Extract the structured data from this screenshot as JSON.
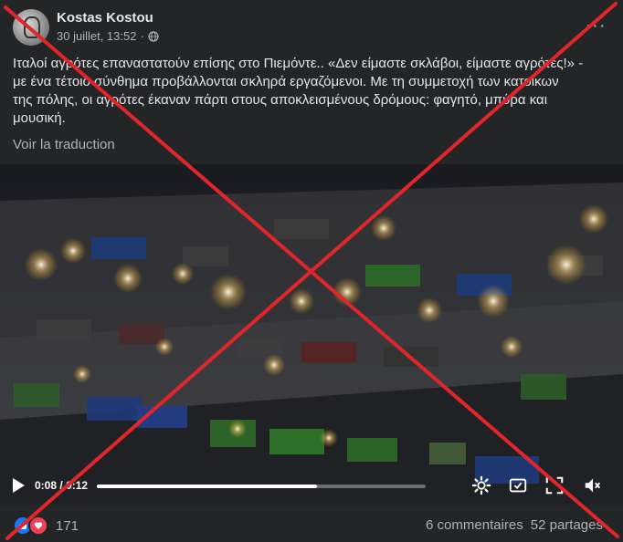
{
  "post": {
    "author": "Kostas Kostou",
    "date": "30 juillet, 13:52",
    "date_separator": "·",
    "text_lines": [
      "Ιταλοί αγρότες επαναστατούν επίσης στο Πιεμόντε.. «Δεν είμαστε σκλάβοι, είμαστε αγρότες!» -",
      "με ένα τέτοιο σύνθημα προβάλλονται σκληρά εργαζόμενοι.  Με τη συμμετοχή των κατοίκων",
      "της πόλης, οι αγρότες έκαναν πάρτι στους αποκλεισμένους δρόμους: φαγητό, μπύρα και",
      "μουσική."
    ],
    "translate_label": "Voir la traduction",
    "more_label": "···"
  },
  "video": {
    "current_time": "0:08",
    "separator": "/",
    "duration": "0:12",
    "progress_fraction": 0.67
  },
  "footer": {
    "reaction_count": "171",
    "comments": "6 commentaires",
    "shares": "52 partages"
  },
  "colors": {
    "background": "#242526",
    "text": "#e4e6eb",
    "muted": "#b0b3b8",
    "like": "#1877f2",
    "love": "#f33e58",
    "cross": "#e0262b"
  },
  "icons": [
    "globe-icon",
    "more-options-icon",
    "play-icon",
    "settings-icon",
    "hd-icon",
    "fullscreen-icon",
    "volume-mute-icon",
    "like-reaction-icon",
    "love-reaction-icon"
  ]
}
